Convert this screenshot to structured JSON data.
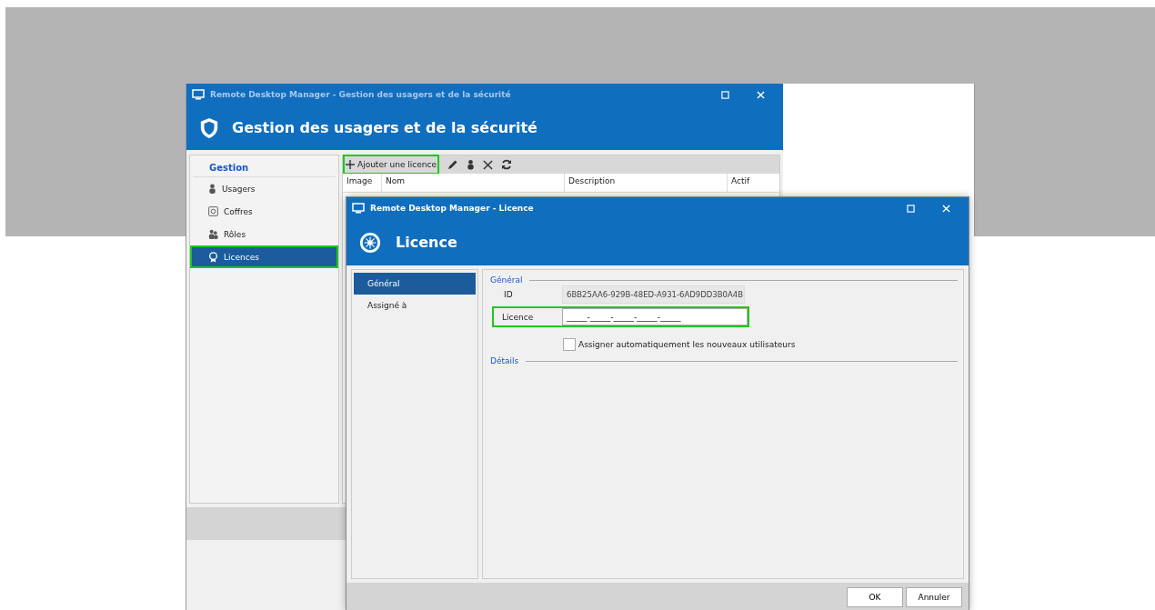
{
  "back_window": {
    "title": "Remote Desktop Manager - Gestion des usagers et de la sécurité",
    "heading": "Gestion des usagers et de la sécurité",
    "sidebar": {
      "header": "Gestion",
      "items": [
        {
          "label": "Usagers",
          "kind": "user",
          "selected": false,
          "highlighted": false
        },
        {
          "label": "Coffres",
          "kind": "vault",
          "selected": false,
          "highlighted": false
        },
        {
          "label": "Rôles",
          "kind": "roles",
          "selected": false,
          "highlighted": false
        },
        {
          "label": "Licences",
          "kind": "licence",
          "selected": true,
          "highlighted": true
        }
      ]
    },
    "toolbar": {
      "add_button": {
        "label": "Ajouter une licence",
        "highlighted": true
      },
      "tools": [
        {
          "kind": "edit"
        },
        {
          "kind": "user"
        },
        {
          "kind": "delete"
        },
        {
          "kind": "refresh"
        }
      ]
    },
    "table": {
      "columns": [
        "Image",
        "Nom",
        "Description",
        "Actif"
      ]
    }
  },
  "dialog": {
    "title": "Remote Desktop Manager - Licence",
    "heading": "Licence",
    "nav": [
      {
        "label": "Général",
        "selected": true
      },
      {
        "label": "Assigné à",
        "selected": false
      }
    ],
    "general_section": "Général",
    "id": {
      "label": "ID",
      "value": "6BB25AA6-929B-48ED-A931-6AD9DD3B0A4B"
    },
    "licence": {
      "label": "Licence",
      "value": "_____-_____-_____-_____-_____",
      "highlighted": true
    },
    "auto_assign": {
      "label": "Assigner automatiquement les nouveaux utilisateurs",
      "checked": false
    },
    "details_section": "Détails",
    "buttons": [
      "OK",
      "Annuler"
    ]
  }
}
